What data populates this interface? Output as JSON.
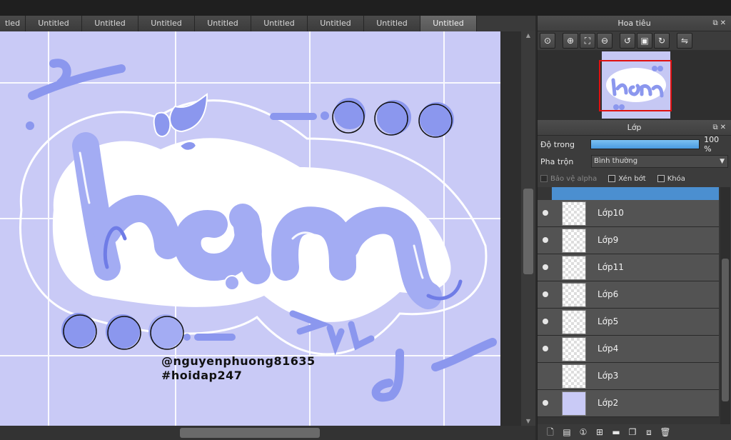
{
  "tabs": [
    "tled",
    "Untitled",
    "Untitled",
    "Untitled",
    "Untitled",
    "Untitled",
    "Untitled",
    "Untitled",
    "Untitled"
  ],
  "active_tab_index": 8,
  "canvas": {
    "watermark_line1": "@nguyenphuong81635",
    "watermark_line2": "#hoidap247",
    "background_color": "#c9caf6",
    "accent_color": "#8b97ee"
  },
  "navigator": {
    "title": "Hoa tiêu",
    "tools": [
      "zoom-reset-icon",
      "zoom-in-icon",
      "fit-icon",
      "zoom-out-icon",
      "rotate-left-icon",
      "fit-rotate-icon",
      "rotate-right-icon",
      "flip-icon"
    ]
  },
  "layers_panel": {
    "title": "Lớp",
    "opacity_label": "Độ trong",
    "opacity_value": "100 %",
    "opacity_fraction": 1.0,
    "blend_label": "Pha trộn",
    "blend_value": "Bình thường",
    "protect_alpha": "Bảo vệ alpha",
    "clipping": "Xén bớt",
    "lock": "Khóa",
    "layers": [
      {
        "name": "Lớp10",
        "visible": true
      },
      {
        "name": "Lớp9",
        "visible": true
      },
      {
        "name": "Lớp11",
        "visible": true
      },
      {
        "name": "Lớp6",
        "visible": true
      },
      {
        "name": "Lớp5",
        "visible": true
      },
      {
        "name": "Lớp4",
        "visible": true
      },
      {
        "name": "Lớp3",
        "visible": false
      },
      {
        "name": "Lớp2",
        "visible": true
      }
    ]
  }
}
